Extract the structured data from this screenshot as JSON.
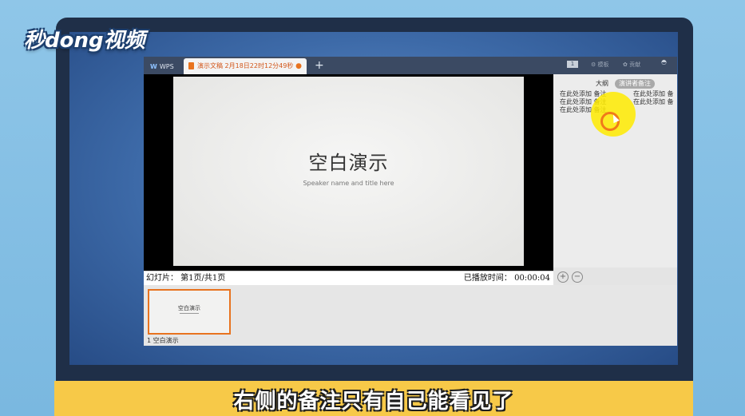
{
  "logo": {
    "text": "秒dong视频"
  },
  "app": {
    "wps_tab_label": "WPS",
    "doc_tab_label": "演示文稿 2月18日22时12分49秒",
    "doc_tab_modified": "●",
    "new_tab": "+",
    "toolbar_badge": "1",
    "toolbar_item_1": "模板",
    "toolbar_item_2": "贡献"
  },
  "slide": {
    "title": "空白演示",
    "subtitle": "Speaker name and title here"
  },
  "status": {
    "left": "幻灯片： 第1页/共1页",
    "right": "已播放时间： 00:00:04"
  },
  "notes": {
    "tab_outline": "大纲",
    "tab_speaker_notes": "演讲者备注",
    "col1": [
      "在此处添加 备注",
      "在此处添加 备注",
      "在此处添加 备注"
    ],
    "col2": [
      "在此处添加 备",
      "在此处添加 备"
    ],
    "zoom_in": "+",
    "zoom_out": "−"
  },
  "thumbnails": [
    {
      "title": "空白演示",
      "caption": "1 空白演示"
    }
  ],
  "caption": {
    "text": "右侧的备注只有自己能看见了"
  },
  "colors": {
    "accent": "#e8731f",
    "subtitle_bg": "#f7c948",
    "titlebar": "#3b4a63"
  }
}
